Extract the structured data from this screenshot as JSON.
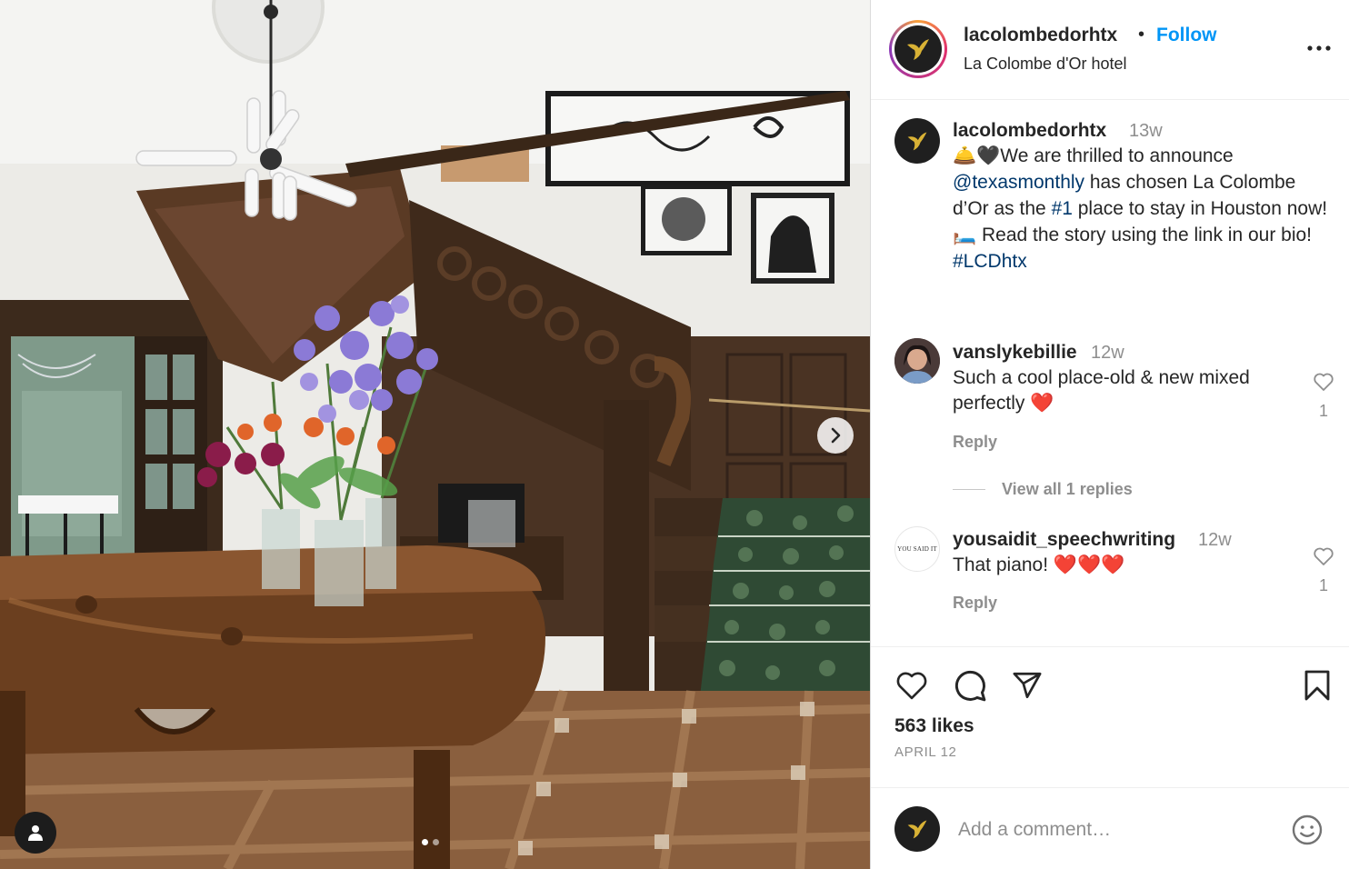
{
  "post": {
    "username": "lacolombedorhtx",
    "follow_label": "Follow",
    "separator": "•",
    "location": "La Colombe d'Or hotel",
    "more_icon": "more-horizontal-icon",
    "photo_alt": "Hotel foyer with grand piano, flowers and wooden staircase",
    "carousel_count": 2,
    "carousel_active": 1
  },
  "caption": {
    "username": "lacolombedorhtx",
    "time": "13w",
    "emoji_prefix": "🛎️🖤",
    "text_1": "We are thrilled to announce ",
    "mention": "@texasmonthly",
    "text_2": " has chosen La Colombe d’Or as the ",
    "hashtag_1": "#1",
    "text_3": " place to stay in Houston now! 🛏️ Read the story using the link in our bio! ",
    "hashtag_2": "#LCDhtx"
  },
  "comments": [
    {
      "username": "vanslykebillie",
      "time": "12w",
      "text": "Such a cool place-old & new mixed perfectly ❤️",
      "likes": "1",
      "reply_label": "Reply"
    },
    {
      "username": "yousaidit_speechwriting",
      "time": "12w",
      "text": "That piano! ❤️❤️❤️",
      "likes": "1",
      "reply_label": "Reply",
      "avatar_text": "YOU SAID IT"
    }
  ],
  "view_replies_label": "View all 1 replies",
  "actions": {
    "likes": "563 likes",
    "date": "APRIL 12",
    "icons": [
      "heart-icon",
      "comment-icon",
      "share-icon",
      "bookmark-icon"
    ]
  },
  "comment_box": {
    "placeholder": "Add a comment…",
    "emoji_icon": "smiley-icon"
  },
  "colors": {
    "link": "#00376b",
    "follow": "#0095f6",
    "muted": "#8e8e8e",
    "text": "#262626"
  }
}
